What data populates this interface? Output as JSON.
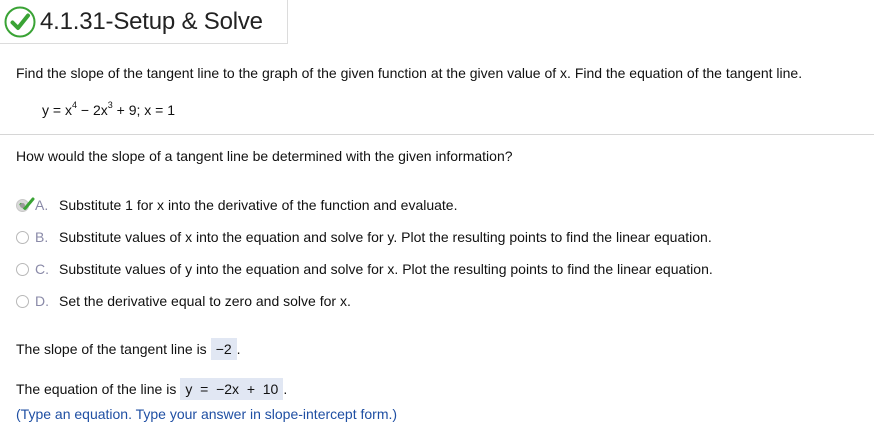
{
  "header": {
    "title": "4.1.31-Setup & Solve"
  },
  "question": {
    "instruction": "Find the slope of the tangent line to the graph of the given function at the given value of x. Find the equation of the tangent line.",
    "equation": {
      "part1": "y = x",
      "exp1": "4",
      "part2": " − 2x",
      "exp2": "3",
      "part3": " + 9; x = 1"
    },
    "prompt": "How would the slope of a tangent line be determined with the given information?"
  },
  "options": [
    {
      "letter": "A.",
      "text": "Substitute 1 for x into the derivative of the function and evaluate.",
      "selected": true,
      "correct": true
    },
    {
      "letter": "B.",
      "text": "Substitute values of x into the equation and solve for y. Plot the resulting points to find the linear equation.",
      "selected": false
    },
    {
      "letter": "C.",
      "text": "Substitute values of y into the equation and solve for x. Plot the resulting points to find the linear equation.",
      "selected": false
    },
    {
      "letter": "D.",
      "text": "Set the derivative equal to zero and solve for x.",
      "selected": false
    }
  ],
  "slope": {
    "label": "The slope of the tangent line is",
    "answer": "−2",
    "period": "."
  },
  "line_eq": {
    "label": "The equation of the line is",
    "answer": "y  =  −2x  +  10",
    "period": "."
  },
  "hint": "(Type an equation. Type your answer in slope-intercept form.)",
  "colors": {
    "correct_green": "#3aa335",
    "hint_blue": "#1f4fa3",
    "answer_bg": "#e1e7f3"
  }
}
